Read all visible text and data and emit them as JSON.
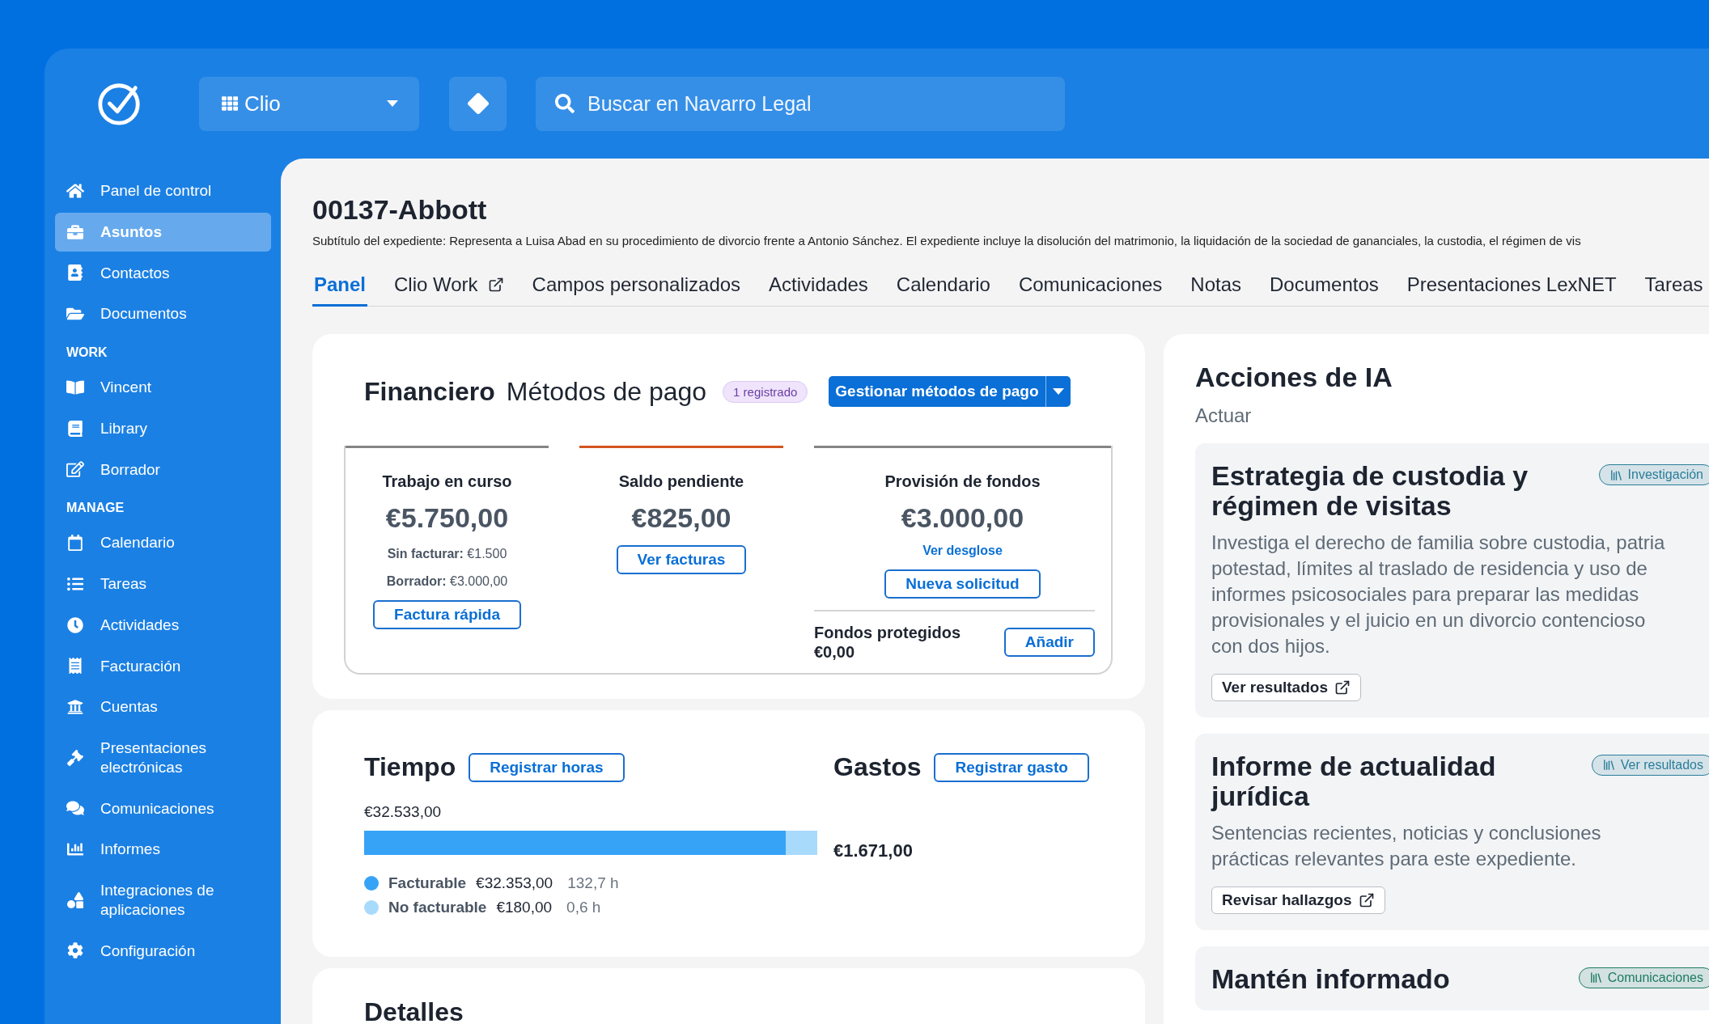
{
  "header": {
    "app_switcher": "Clio",
    "search": {
      "placeholder": "Buscar en Navarro Legal"
    }
  },
  "sidebar": {
    "sections": [
      {
        "items": [
          {
            "label": "Panel de control",
            "selected": false
          },
          {
            "label": "Asuntos",
            "selected": true
          },
          {
            "label": "Contactos",
            "selected": false
          },
          {
            "label": "Documentos",
            "selected": false
          }
        ]
      },
      {
        "label": "WORK",
        "items": [
          {
            "label": "Vincent",
            "selected": false
          },
          {
            "label": "Library",
            "selected": false
          },
          {
            "label": "Borrador",
            "selected": false
          }
        ]
      },
      {
        "label": "MANAGE",
        "items": [
          {
            "label": "Calendario",
            "selected": false
          },
          {
            "label": "Tareas",
            "selected": false
          },
          {
            "label": "Actividades",
            "selected": false
          },
          {
            "label": "Facturación",
            "selected": false
          },
          {
            "label": "Cuentas",
            "selected": false
          },
          {
            "label": "Presentaciones electrónicas",
            "selected": false
          },
          {
            "label": "Comunicaciones",
            "selected": false
          },
          {
            "label": "Informes",
            "selected": false
          },
          {
            "label": "Integraciones de aplicaciones",
            "selected": false
          },
          {
            "label": "Configuración",
            "selected": false
          }
        ]
      }
    ]
  },
  "matter": {
    "title": "00137-Abbott",
    "subtitle": "Subtítulo del expediente: Representa a Luisa Abad en su procedimiento de divorcio frente a Antonio Sánchez. El expediente incluye la disolución del matrimonio, la liquidación de la sociedad de gananciales, la custodia, el régimen de vis"
  },
  "tabs": [
    {
      "label": "Panel",
      "selected": true,
      "external": false
    },
    {
      "label": "Clio Work",
      "selected": false,
      "external": true
    },
    {
      "label": "Campos personalizados",
      "selected": false,
      "external": false
    },
    {
      "label": "Actividades",
      "selected": false,
      "external": false
    },
    {
      "label": "Calendario",
      "selected": false,
      "external": false
    },
    {
      "label": "Comunicaciones",
      "selected": false,
      "external": false
    },
    {
      "label": "Notas",
      "selected": false,
      "external": false
    },
    {
      "label": "Documentos",
      "selected": false,
      "external": false
    },
    {
      "label": "Presentaciones LexNET",
      "selected": false,
      "external": false
    },
    {
      "label": "Tareas",
      "selected": false,
      "external": false
    }
  ],
  "financial": {
    "title": "Financiero",
    "subtitle": "Métodos de pago",
    "badge": "1 registrado",
    "action": "Gestionar métodos de pago",
    "summary": [
      {
        "color": "#858585",
        "title": "Trabajo en curso",
        "amount": "€5.750,00",
        "details": [
          "**Sin facturar:** €1.500",
          "**Borrador:** €3.000,00"
        ],
        "button": "Factura rápida"
      },
      {
        "color": "#d4541f",
        "title": "Saldo pendiente",
        "amount": "€825,00",
        "button": "Ver facturas"
      },
      {
        "color": "#858585",
        "title": "Provisión de fondos",
        "amount": "€3.000,00",
        "link": "Ver desglose",
        "button": "Nueva solicitud",
        "protected": {
          "label": "Fondos protegidos",
          "amount": "€0,00",
          "button": "Añadir"
        }
      }
    ]
  },
  "time": {
    "title": "Tiempo",
    "button": "Registrar horas",
    "total": "€32.533,00",
    "level": 0.93,
    "legend": [
      {
        "label": "Facturable",
        "amount": "€32.353,00",
        "hours": "132,7 h",
        "color": "#36a3f7"
      },
      {
        "label": "No facturable",
        "amount": "€180,00",
        "hours": "0,6 h",
        "color": "#a8dafc"
      }
    ]
  },
  "expenses": {
    "title": "Gastos",
    "button": "Registrar gasto",
    "total": "€1.671,00"
  },
  "details": {
    "title": "Detalles"
  },
  "ai": {
    "title": "Acciones de IA",
    "subtitle": "Actuar",
    "cards": [
      {
        "title": "Estrategia de custodia y régimen de visitas",
        "badge": "Investigación",
        "color": "#2a7d99",
        "description": "Investiga el derecho de familia sobre custodia, patria potestad, límites al traslado de residencia y uso de informes psicosociales para preparar las medidas provisionales y el juicio en un divorcio contencioso con dos hijos.",
        "button": "Ver resultados"
      },
      {
        "title": "Informe de actualidad jurídica",
        "badge": "Ver resultados",
        "color": "#2a7d99",
        "description": "Sentencias recientes, noticias y conclusiones prácticas relevantes para este expediente.",
        "button": "Revisar hallazgos"
      },
      {
        "title": "Mantén informado",
        "badge": "Comunicaciones",
        "color": "#1e7a64"
      }
    ]
  }
}
